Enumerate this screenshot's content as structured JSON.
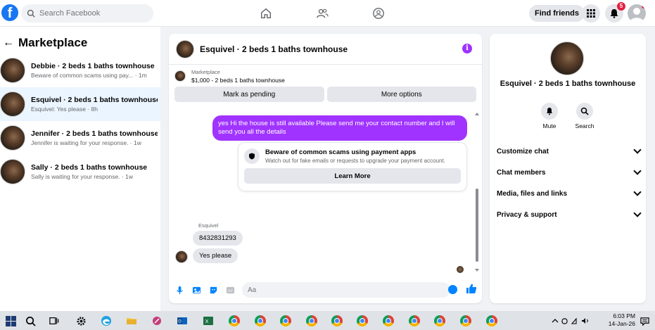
{
  "topbar": {
    "logo": "f",
    "search_placeholder": "Search Facebook",
    "find_friends": "Find friends",
    "notifications_count": "5",
    "nav_icons": [
      "home-icon",
      "friends-icon",
      "groups-icon"
    ]
  },
  "marketplace": {
    "back_title": "Marketplace",
    "conversations": [
      {
        "title": "Debbie · 2 beds 1 baths townhouse",
        "subtitle": "Beware of common scams using pay... · 1m"
      },
      {
        "title": "Esquivel · 2 beds 1 baths townhouse",
        "subtitle": "Esquivel: Yes please · 8h"
      },
      {
        "title": "Jennifer · 2 beds 1 baths townhouse",
        "subtitle": "Jennifer is waiting for your response. · 1w"
      },
      {
        "title": "Sally · 2 beds 1 baths townhouse",
        "subtitle": "Sally is waiting for your response. · 1w"
      }
    ]
  },
  "chat": {
    "header_title": "Esquivel · 2 beds 1 baths townhouse",
    "info_icon": "i",
    "listing_label": "Marketplace",
    "listing_item": "$1,000 - 2 beds 1 baths townhouse",
    "mark_pending": "Mark as pending",
    "more_options": "More options",
    "outgoing_message": "yes Hi the house is still available Please send me your contact number and I will send you all the details",
    "scam_title": "Beware of common scams using payment apps",
    "scam_subtitle": "Watch out for fake emails or requests to upgrade your payment account.",
    "learn_more": "Learn More",
    "sender_name": "Esquivel",
    "incoming_1": "8432831293",
    "incoming_2": "Yes please",
    "composer_placeholder": "Aa"
  },
  "details": {
    "title": "Esquivel · 2 beds 1 baths townhouse",
    "mute": "Mute",
    "search": "Search",
    "menu": [
      "Customize chat",
      "Chat members",
      "Media, files and links",
      "Privacy & support"
    ]
  },
  "taskbar": {
    "time": "6:03 PM",
    "date": "14-Jan-26"
  },
  "colors": {
    "brand": "#1877f2",
    "accent_purple": "#a033ff",
    "active_conv": "#ebf5ff"
  }
}
